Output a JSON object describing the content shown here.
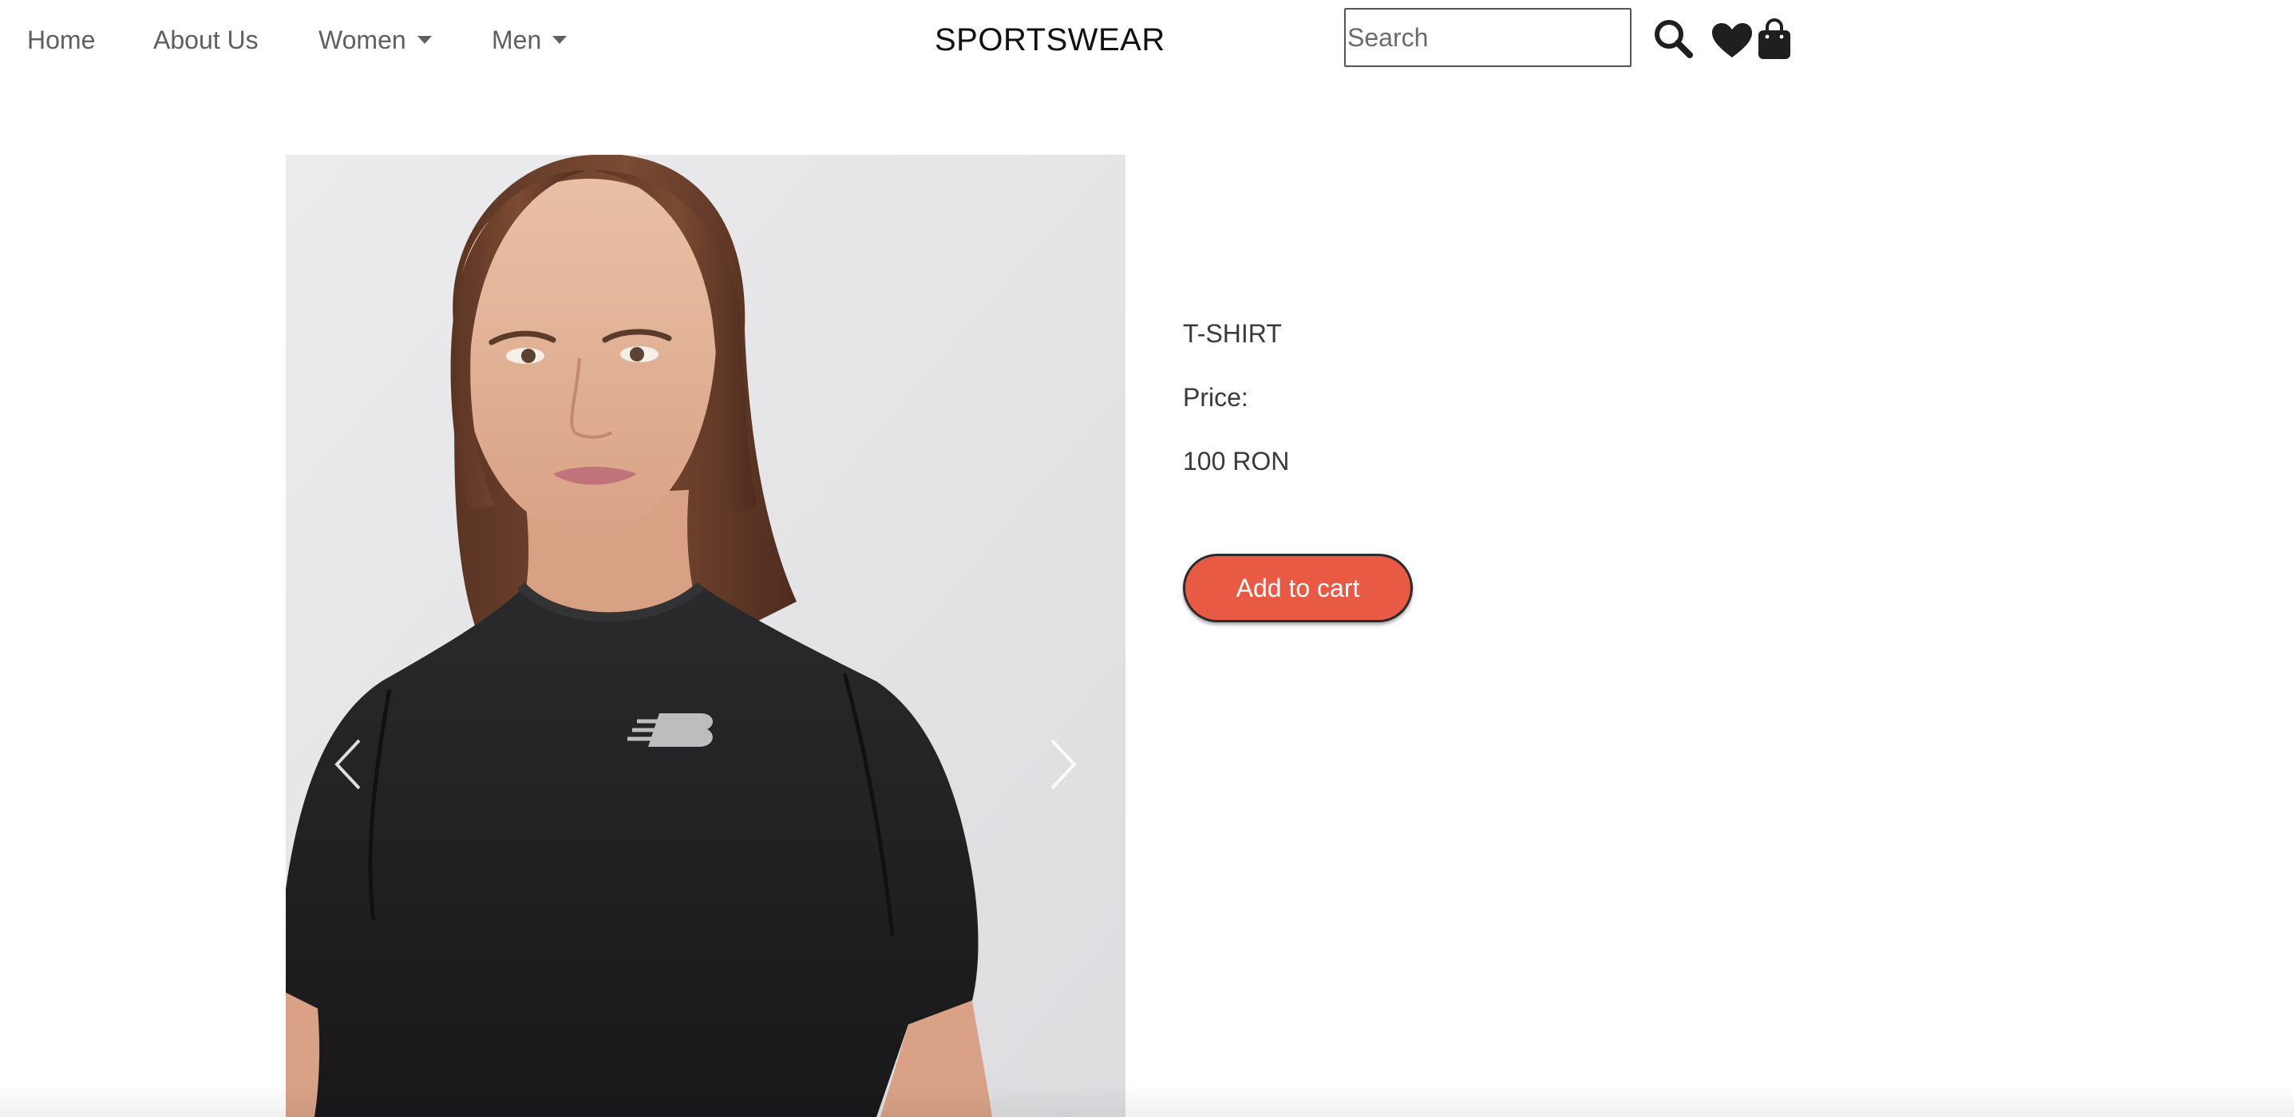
{
  "nav": {
    "home": "Home",
    "about": "About Us",
    "women": "Women",
    "men": "Men"
  },
  "brand": "SPORTSWEAR",
  "search": {
    "placeholder": "Search",
    "value": ""
  },
  "icons": {
    "search": "search-icon",
    "wishlist": "heart-icon",
    "cart": "shopping-bag-icon",
    "prev": "chevron-left-icon",
    "next": "chevron-right-icon"
  },
  "product": {
    "name": "T-SHIRT",
    "price_label": "Price:",
    "price_value": "100 RON",
    "add_to_cart": "Add to cart"
  },
  "colors": {
    "accent": "#e95a44",
    "shirt": "#1e1e1f",
    "image_background": "#e6e6e8"
  }
}
